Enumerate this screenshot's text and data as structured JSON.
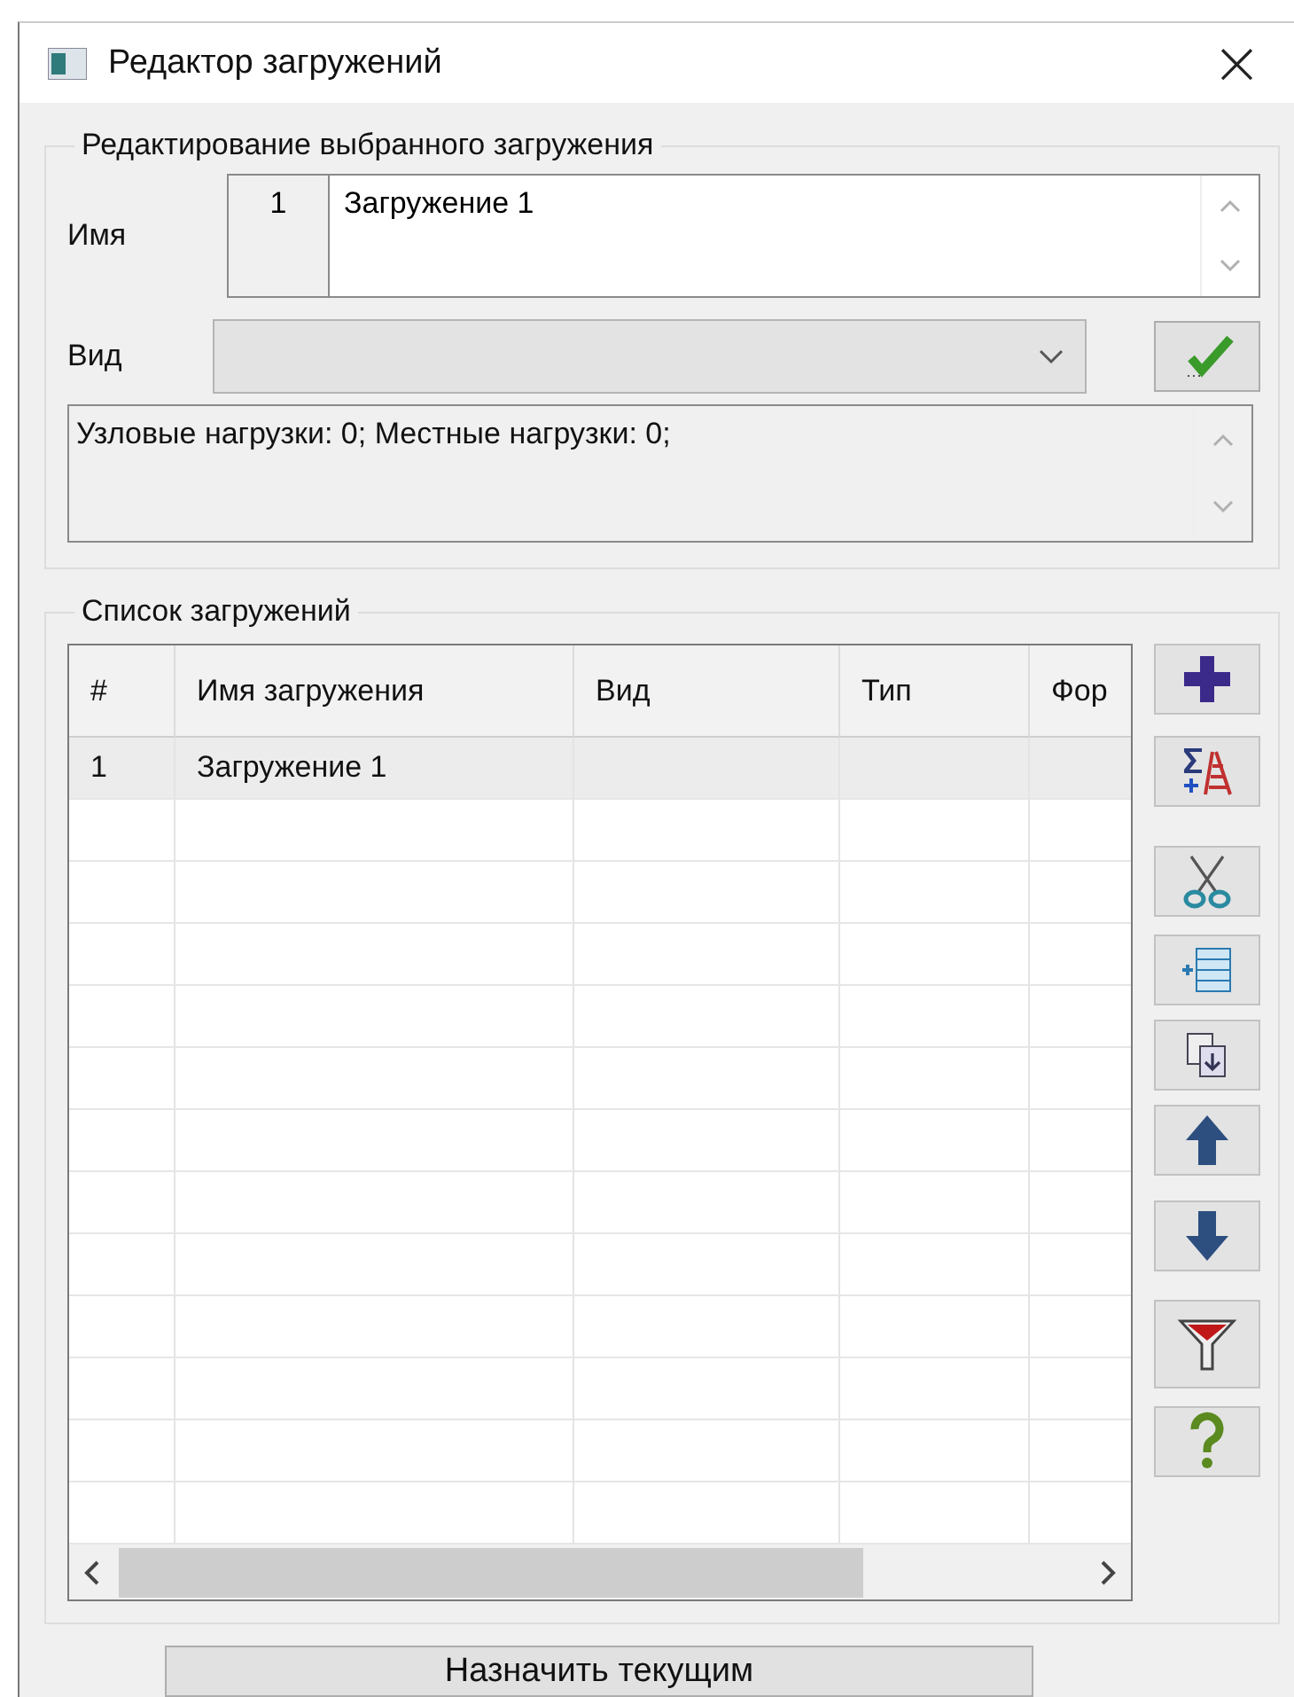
{
  "window": {
    "title": "Редактор загружений",
    "close": "×"
  },
  "edit_group": {
    "title": "Редактирование выбранного загружения",
    "name_label": "Имя",
    "name_number": "1",
    "name_value": "Загружение 1",
    "kind_label": "Вид",
    "info": "Узловые нагрузки:  0;  Местные нагрузки:  0;"
  },
  "list_group": {
    "title": "Список загружений",
    "table": {
      "columns": [
        "#",
        "Имя загружения",
        "Вид",
        "Тип",
        "Фор"
      ],
      "rows": [
        {
          "number": "1",
          "name": "Загружение 1",
          "selected": true
        }
      ]
    },
    "tools": [
      {
        "kind": "add"
      },
      {
        "kind": "sum"
      },
      {
        "kind": "cut"
      },
      {
        "kind": "insert"
      },
      {
        "kind": "copy"
      },
      {
        "kind": "up"
      },
      {
        "kind": "down"
      },
      {
        "kind": "filter"
      },
      {
        "kind": "help"
      }
    ]
  },
  "apply_button": "Назначить текущим"
}
